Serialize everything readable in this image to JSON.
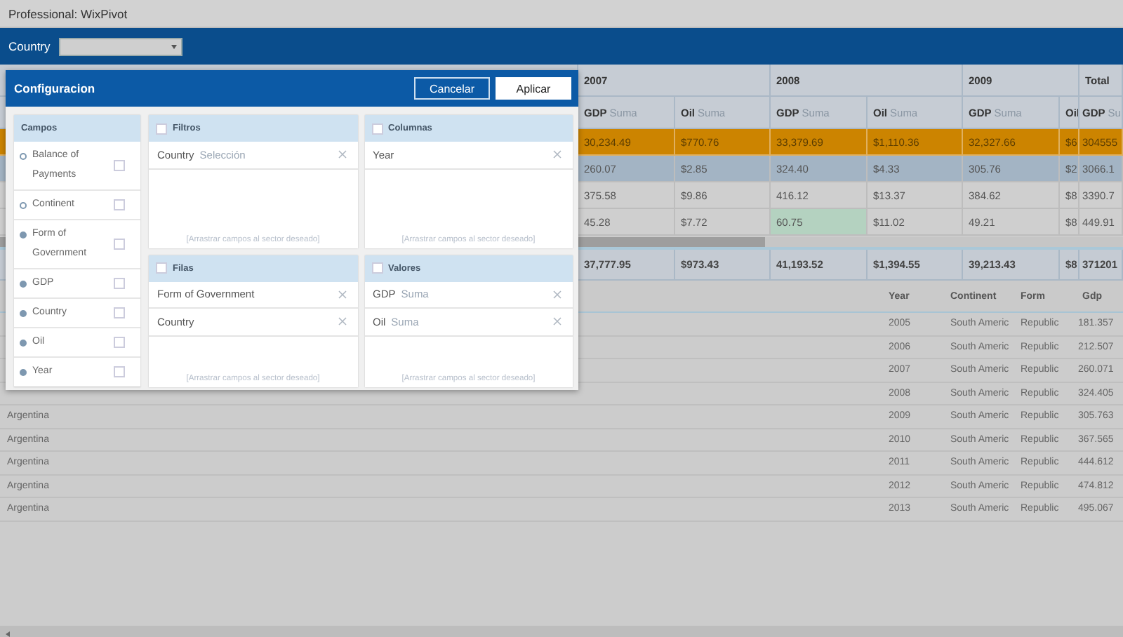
{
  "app_title": "Professional: WixPivot",
  "toolbar": {
    "filters": [
      {
        "label": "Country"
      }
    ]
  },
  "pivot": {
    "column_groups": [
      {
        "label": "2007",
        "measures": [
          {
            "measure": "GDP",
            "aggregate": "Suma"
          },
          {
            "measure": "Oil",
            "aggregate": "Suma"
          }
        ]
      },
      {
        "label": "2008",
        "measures": [
          {
            "measure": "GDP",
            "aggregate": "Suma"
          },
          {
            "measure": "Oil",
            "aggregate": "Suma"
          }
        ]
      },
      {
        "label": "2009",
        "measures": [
          {
            "measure": "GDP",
            "aggregate": "Suma"
          },
          {
            "measure": "Oil"
          }
        ]
      },
      {
        "label": "Total",
        "measures": [
          {
            "measure": "GDP",
            "aggregate": "Su"
          }
        ]
      }
    ],
    "rows": [
      {
        "kind": "group",
        "cells": [
          {
            "text": "30,234.49",
            "highlighted": false
          },
          {
            "text": "$770.76",
            "highlighted": false
          },
          {
            "text": "33,379.69",
            "highlighted": false
          },
          {
            "text": "$1,110.36",
            "highlighted": false
          },
          {
            "text": "32,327.66",
            "highlighted": false
          },
          {
            "text": "$6",
            "highlighted": false
          },
          {
            "text": "304555",
            "highlighted": false
          }
        ]
      },
      {
        "kind": "subgroup",
        "cells": [
          {
            "text": "260.07",
            "highlighted": false
          },
          {
            "text": "$2.85",
            "highlighted": false
          },
          {
            "text": "324.40",
            "highlighted": false
          },
          {
            "text": "$4.33",
            "highlighted": false
          },
          {
            "text": "305.76",
            "highlighted": false
          },
          {
            "text": "$2.",
            "highlighted": false
          },
          {
            "text": "3066.1",
            "highlighted": false
          }
        ]
      },
      {
        "kind": "item",
        "cells": [
          {
            "text": "375.58",
            "highlighted": false
          },
          {
            "text": "$9.86",
            "highlighted": false
          },
          {
            "text": "416.12",
            "highlighted": false
          },
          {
            "text": "$13.37",
            "highlighted": false
          },
          {
            "text": "384.62",
            "highlighted": false
          },
          {
            "text": "$8.",
            "highlighted": false
          },
          {
            "text": "3390.7",
            "highlighted": false
          }
        ]
      },
      {
        "kind": "item",
        "cells": [
          {
            "text": "45.28",
            "highlighted": false
          },
          {
            "text": "$7.72",
            "highlighted": false
          },
          {
            "text": "60.75",
            "highlighted": true
          },
          {
            "text": "$11.02",
            "highlighted": false
          },
          {
            "text": "49.21",
            "highlighted": false
          },
          {
            "text": "$8.",
            "highlighted": false
          },
          {
            "text": "449.91",
            "highlighted": false
          }
        ]
      }
    ],
    "totals": [
      "37,777.95",
      "$973.43",
      "41,193.52",
      "$1,394.55",
      "39,213.43",
      "$8",
      "371201"
    ]
  },
  "detail": {
    "columns": [
      "Year",
      "Continent",
      "Form",
      "Gdp"
    ],
    "rows": [
      {
        "year": "2005",
        "continent": "South Americ",
        "form": "Republic",
        "gdp": "181.357"
      },
      {
        "year": "2006",
        "continent": "South Americ",
        "form": "Republic",
        "gdp": "212.507"
      },
      {
        "year": "2007",
        "continent": "South Americ",
        "form": "Republic",
        "gdp": "260.071"
      },
      {
        "year": "2008",
        "continent": "South Americ",
        "form": "Republic",
        "gdp": "324.405"
      },
      {
        "country": "Argentina",
        "year": "2009",
        "continent": "South Americ",
        "form": "Republic",
        "gdp": "305.763"
      },
      {
        "country": "Argentina",
        "year": "2010",
        "continent": "South Americ",
        "form": "Republic",
        "gdp": "367.565"
      },
      {
        "country": "Argentina",
        "year": "2011",
        "continent": "South Americ",
        "form": "Republic",
        "gdp": "444.612"
      },
      {
        "country": "Argentina",
        "year": "2012",
        "continent": "South Americ",
        "form": "Republic",
        "gdp": "474.812"
      },
      {
        "country": "Argentina",
        "year": "2013",
        "continent": "South Americ",
        "form": "Republic",
        "gdp": "495.067"
      }
    ]
  },
  "dialog": {
    "title": "Configuracion",
    "buttons": [
      {
        "label": "Cancelar",
        "kind": "secondary"
      },
      {
        "label": "Aplicar",
        "kind": "primary"
      }
    ],
    "fields": {
      "title": "Campos",
      "items": [
        {
          "label": "Balance of Payments",
          "used": false,
          "checked": false
        },
        {
          "label": "Continent",
          "used": false,
          "checked": false
        },
        {
          "label": "Form of Government",
          "used": true,
          "checked": false
        },
        {
          "label": "GDP",
          "used": true,
          "checked": false
        },
        {
          "label": "Country",
          "used": true,
          "checked": false
        },
        {
          "label": "Oil",
          "used": true,
          "checked": false
        },
        {
          "label": "Year",
          "used": true,
          "checked": false
        }
      ]
    },
    "zones": [
      {
        "title": "Filtros",
        "checked": false,
        "items": [
          {
            "field": "Country",
            "detail": "Selección"
          }
        ],
        "hint": "[Arrastrar campos al sector deseado]"
      },
      {
        "title": "Columnas",
        "checked": false,
        "items": [
          {
            "field": "Year"
          }
        ],
        "hint": "[Arrastrar campos al sector deseado]"
      },
      {
        "title": "Filas",
        "checked": false,
        "items": [
          {
            "field": "Form of Government"
          },
          {
            "field": "Country"
          }
        ],
        "hint": "[Arrastrar campos al sector deseado]"
      },
      {
        "title": "Valores",
        "checked": false,
        "items": [
          {
            "field": "GDP",
            "detail": "Suma"
          },
          {
            "field": "Oil",
            "detail": "Suma"
          }
        ],
        "hint": "[Arrastrar campos al sector deseado]"
      }
    ]
  }
}
